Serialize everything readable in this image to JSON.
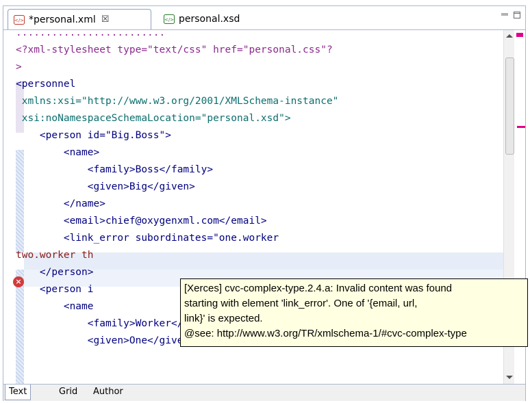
{
  "tabs": [
    {
      "label": "*personal.xml",
      "icon": "xml-file-icon",
      "close": "☒"
    },
    {
      "label": "personal.xsd",
      "icon": "xsd-file-icon"
    }
  ],
  "editor": {
    "lines": [
      {
        "text": ".........................",
        "cls": "c-pi"
      },
      {
        "text": "<?xml-stylesheet type=\"text/css\" href=\"personal.css\"?",
        "cls": "c-pi"
      },
      {
        "text": ">",
        "cls": "c-pi"
      },
      {
        "text": "<personnel",
        "cls": "c-tag"
      },
      {
        "text": " xmlns:xsi=\"http://www.w3.org/2001/XMLSchema-instance\"",
        "cls": "c-ns"
      },
      {
        "text": " xsi:noNamespaceSchemaLocation=\"personal.xsd\">",
        "cls": "c-ns"
      },
      {
        "text": "    <person id=\"Big.Boss\">",
        "cls": "c-tag"
      },
      {
        "text": "        <name>",
        "cls": "c-tag"
      },
      {
        "text": "            <family>Boss</family>",
        "cls": "c-tag"
      },
      {
        "text": "            <given>Big</given>",
        "cls": "c-tag"
      },
      {
        "text": "        </name>",
        "cls": "c-tag"
      },
      {
        "text": "        <email>chief@oxygenxml.com</email>",
        "cls": "c-tag"
      },
      {
        "text": "        <link_error subordinates=\"one.worker",
        "cls": "c-tag"
      },
      {
        "text": "two.worker th",
        "cls": "c-val"
      },
      {
        "text": "    </person>",
        "cls": "c-tag"
      },
      {
        "text": "    <person i",
        "cls": "c-tag"
      },
      {
        "text": "        <name",
        "cls": "c-tag"
      },
      {
        "text": "            <family>Worker</family>",
        "cls": "c-tag"
      },
      {
        "text": "            <given>One</given>",
        "cls": "c-tag"
      }
    ]
  },
  "tooltip": {
    "line1": "[Xerces] cvc-complex-type.2.4.a: Invalid content was found",
    "line2": "starting with element 'link_error'. One of '{email, url,",
    "line3": "link}' is expected.",
    "line4": "@see: http://www.w3.org/TR/xmlschema-1/#cvc-complex-type"
  },
  "bottom_tabs": [
    "Text",
    "Grid",
    "Author"
  ],
  "colors": {
    "error": "#d23b3b",
    "marker": "#e0008a",
    "tooltip_bg": "#ffffe1"
  }
}
